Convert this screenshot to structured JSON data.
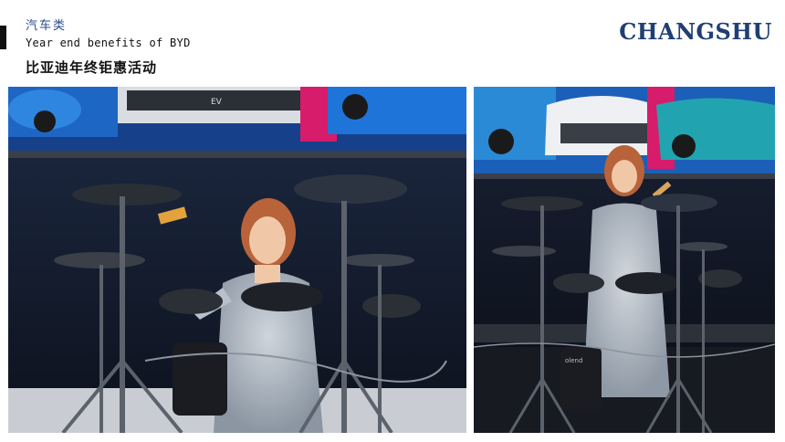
{
  "header": {
    "category": "汽车类",
    "subtitle_en": "Year end benefits of BYD",
    "title_zh": "比亚迪年终钜惠活动",
    "brand": "CHANGSHU"
  },
  "colors": {
    "brand": "#1f3f73",
    "category": "#2a4a8c",
    "accent_bar": "#111111"
  },
  "photos": {
    "left": {
      "screen_badge": "EV"
    },
    "right": {
      "drum_brand": "olend"
    }
  }
}
